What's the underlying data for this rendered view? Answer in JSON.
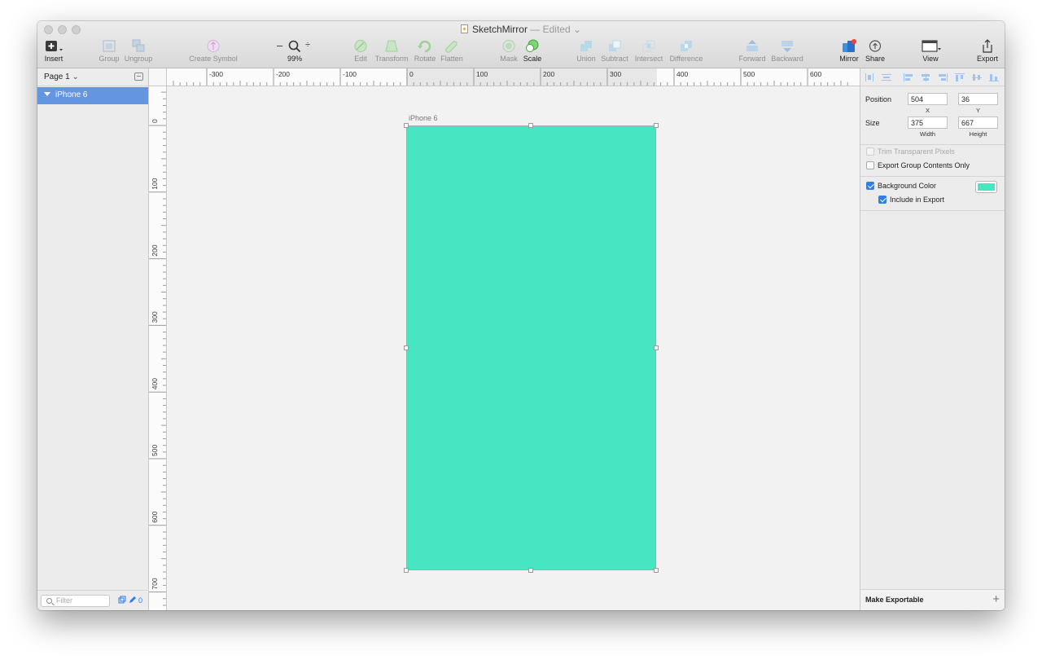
{
  "window": {
    "title": "SketchMirror",
    "status": "— Edited",
    "status_caret": "⌄"
  },
  "toolbar": {
    "insert": "Insert",
    "group": "Group",
    "ungroup": "Ungroup",
    "create_symbol": "Create Symbol",
    "zoom_minus": "–",
    "zoom_plus": "÷",
    "zoom_level": "99%",
    "edit": "Edit",
    "transform": "Transform",
    "rotate": "Rotate",
    "flatten": "Flatten",
    "mask": "Mask",
    "scale": "Scale",
    "union": "Union",
    "subtract": "Subtract",
    "intersect": "Intersect",
    "difference": "Difference",
    "forward": "Forward",
    "backward": "Backward",
    "mirror": "Mirror",
    "share": "Share",
    "view": "View",
    "export": "Export"
  },
  "sidebar": {
    "page_label": "Page 1",
    "page_caret": "⌄",
    "layers": [
      {
        "name": "iPhone 6"
      }
    ],
    "filter_placeholder": "Filter",
    "slice_count": "0"
  },
  "rulers": {
    "horizontal": [
      "-300",
      "-200",
      "-100",
      "0",
      "100",
      "200",
      "300",
      "400",
      "500",
      "600"
    ],
    "vertical": [
      "0",
      "100",
      "200",
      "300",
      "400",
      "500",
      "600",
      "700"
    ]
  },
  "canvas": {
    "artboard_name": "iPhone 6",
    "artboard_color": "#48e5c2"
  },
  "inspector": {
    "position_label": "Position",
    "x_value": "504",
    "y_value": "36",
    "x_label": "X",
    "y_label": "Y",
    "size_label": "Size",
    "width_value": "375",
    "height_value": "667",
    "width_label": "Width",
    "height_label": "Height",
    "trim_label": "Trim Transparent Pixels",
    "export_group_label": "Export Group Contents Only",
    "background_color_label": "Background Color",
    "include_export_label": "Include in Export",
    "background_color": "#48e5c2",
    "make_exportable": "Make Exportable",
    "add": "+"
  }
}
